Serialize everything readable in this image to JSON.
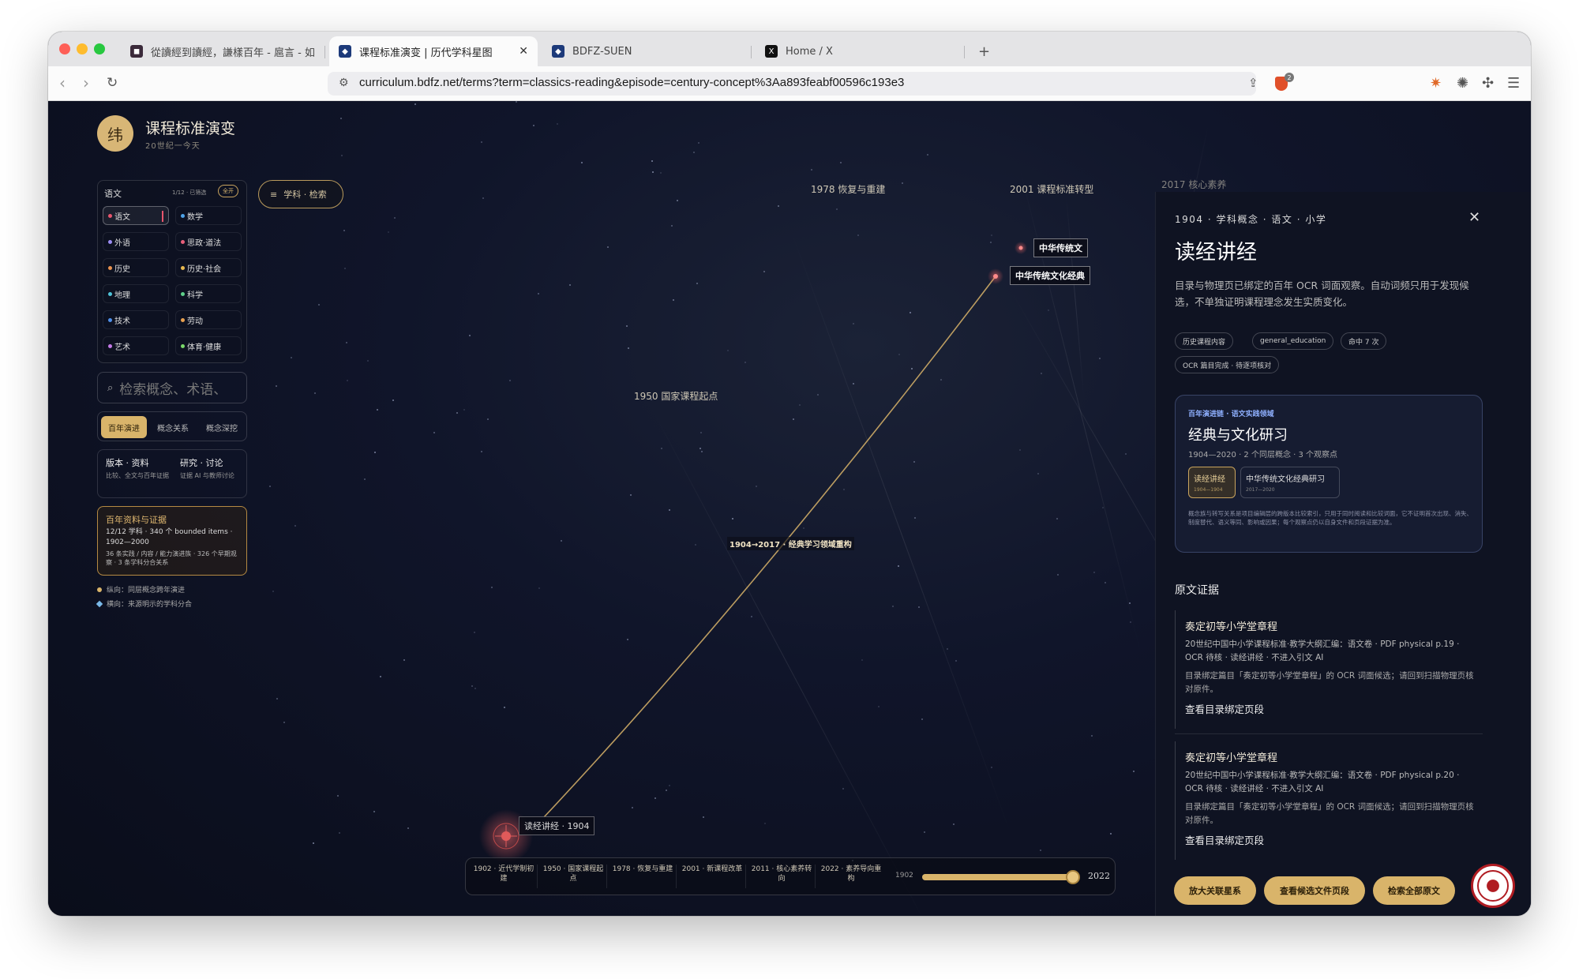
{
  "browser": {
    "tabs": [
      {
        "title": "從讀經到讀經，謙樣百年 - 扈言 - 如",
        "active": false
      },
      {
        "title": "课程标准演变 | 历代学科星图",
        "active": true
      },
      {
        "title": "BDFZ-SUEN",
        "active": false
      },
      {
        "title": "Home / X",
        "active": false
      }
    ],
    "url": "curriculum.bdfz.net/terms?term=classics-reading&episode=century-concept%3Aa893feabf00596c193e3",
    "extension_badge": "2"
  },
  "app": {
    "logo_char": "纬",
    "title": "课程标准演变",
    "subtitle": "20世纪一今天"
  },
  "subjects_panel": {
    "header": "语文",
    "count": "1/12 · 已筛选",
    "all_button": "全开",
    "items": [
      {
        "label": "语文",
        "color": "#e8556d",
        "selected": true
      },
      {
        "label": "数学",
        "color": "#4fa3e8"
      },
      {
        "label": "外语",
        "color": "#9b8cf2"
      },
      {
        "label": "思政·道法",
        "color": "#e85f7a"
      },
      {
        "label": "历史",
        "color": "#e8924f"
      },
      {
        "label": "历史·社会",
        "color": "#e8b94f"
      },
      {
        "label": "地理",
        "color": "#4fc3d8"
      },
      {
        "label": "科学",
        "color": "#5fd08a"
      },
      {
        "label": "技术",
        "color": "#4f8fe8"
      },
      {
        "label": "劳动",
        "color": "#e8a04f"
      },
      {
        "label": "艺术",
        "color": "#c57ae8"
      },
      {
        "label": "体育·健康",
        "color": "#7ad86a"
      }
    ]
  },
  "search": {
    "placeholder": "检索概念、术语、"
  },
  "modes": [
    {
      "label": "百年演进",
      "active": true
    },
    {
      "label": "概念关系",
      "active": false
    },
    {
      "label": "概念深挖",
      "active": false
    }
  ],
  "info_boxes": [
    {
      "title": "版本 · 资料",
      "desc": "比较、全文与百年证据"
    },
    {
      "title": "研究 · 讨论",
      "desc": "证据 AI 与教师讨论"
    }
  ],
  "evidence_box": {
    "title": "百年资料与证据",
    "line1": "12/12 学科 · 340 个 bounded items · 1902—2000",
    "line2": "36 条实践 / 内容 / 能力演进族 · 326 个早期观察 · 3 条学科分合关系"
  },
  "legend": [
    {
      "label": "纵向：同层概念跨年演进",
      "shape": "dot",
      "color": "#d9b46a"
    },
    {
      "label": "横向：来源明示的学科分合",
      "shape": "diamond",
      "color": "#7ab8e8"
    }
  ],
  "filter_pill": {
    "label": "学科 · 检索"
  },
  "eras": [
    {
      "label": "1950 国家课程起点"
    },
    {
      "label": "1978 恢复与重建"
    },
    {
      "label": "2001 课程标准转型"
    },
    {
      "label": "2017 核心素养"
    }
  ],
  "graph": {
    "start_node": "读经讲经 · 1904",
    "mid_label": "1904→2017 · 经典学习领域重构",
    "end_node_1": "中华传统文",
    "end_node_2": "中华传统文化经典"
  },
  "timeline": {
    "stops": [
      "1902 · 近代学制初建",
      "1950 · 国家课程起点",
      "1978 · 恢复与重建",
      "2001 · 新课程改革",
      "2011 · 核心素养转向",
      "2022 · 素养导向重构"
    ],
    "range_start": "1902",
    "range_end": "2022",
    "slider_fraction": 1.0
  },
  "detail": {
    "breadcrumb": "1904 · 学科概念 · 语文 · 小学",
    "title": "读经讲经",
    "description": "目录与物理页已绑定的百年 OCR 词面观察。自动词频只用于发现候选，不单独证明课程理念发生实质变化。",
    "chips": [
      "历史课程内容",
      "general_education",
      "命中 7 次",
      "OCR 篇目完成 · 待逐项核对"
    ],
    "card": {
      "kicker": "百年演进链 · 语文实践领域",
      "title": "经典与文化研习",
      "meta": "1904—2020 · 2 个同层概念 · 3 个观察点",
      "nodes": [
        {
          "label": "读经讲经",
          "years": "1904—1904",
          "active": true
        },
        {
          "label": "中华传统文化经典研习",
          "years": "2017—2020",
          "active": false
        }
      ],
      "note": "概念族与转写关系是项目编辑层的跨版本比较索引，只用于同时阅读和比较词面，它不证明首次出现、消失、制度替代、语义等同、影响或因果；每个观察点仍以自身文件和页段证据为准。"
    },
    "evidence_heading": "原文证据",
    "evidence": [
      {
        "title": "奏定初等小学堂章程",
        "source": "20世纪中国中小学课程标准·教学大纲汇编：语文卷 · PDF physical p.19 · OCR 待核 · 读经讲经 · 不进入引文 AI",
        "note": "目录绑定篇目「奏定初等小学堂章程」的 OCR 词面候选；请回到扫描物理页核对原件。",
        "link": "查看目录绑定页段"
      },
      {
        "title": "奏定初等小学堂章程",
        "source": "20世纪中国中小学课程标准·教学大纲汇编：语文卷 · PDF physical p.20 · OCR 待核 · 读经讲经 · 不进入引文 AI",
        "note": "目录绑定篇目「奏定初等小学堂章程」的 OCR 词面候选；请回到扫描物理页核对原件。",
        "link": "查看目录绑定页段"
      }
    ],
    "buttons": [
      "放大关联星系",
      "查看候选文件页段",
      "检索全部原文"
    ]
  }
}
